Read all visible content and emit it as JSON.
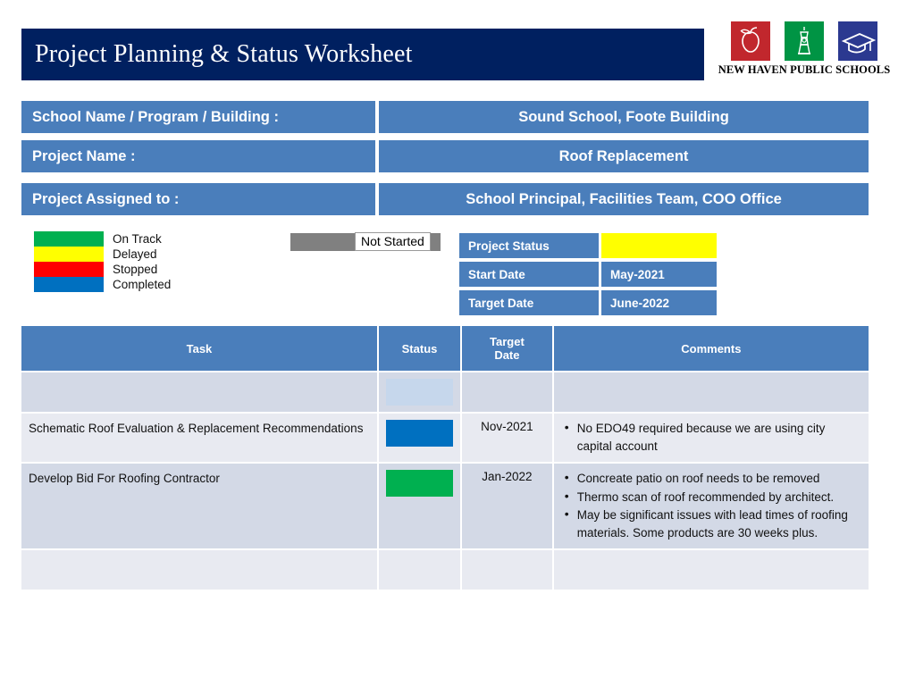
{
  "title": "Project Planning & Status Worksheet",
  "logo": {
    "caption": "NEW HAVEN PUBLIC SCHOOLS",
    "marks": [
      {
        "name": "apple-logo-icon",
        "color": "#C1272D"
      },
      {
        "name": "lighthouse-logo-icon",
        "color": "#009444"
      },
      {
        "name": "graduation-cap-logo-icon",
        "color": "#2B3990"
      }
    ]
  },
  "info_rows": [
    {
      "label": "School Name / Program / Building :",
      "value": "Sound School, Foote Building"
    },
    {
      "label": "Project Name :",
      "value": "Roof Replacement"
    },
    {
      "label": "Project Assigned to :",
      "value": "School Principal, Facilities Team, COO Office"
    }
  ],
  "legend": [
    {
      "label": "On Track",
      "color": "#00B050"
    },
    {
      "label": "Delayed",
      "color": "#FFFF00"
    },
    {
      "label": "Stopped",
      "color": "#FF0000"
    },
    {
      "label": "Completed",
      "color": "#0070C0"
    }
  ],
  "not_started": {
    "label": "Not Started",
    "color": "#808080"
  },
  "status_panel": [
    {
      "key": "Project Status",
      "value": "",
      "swatch_color": "#FFFF00"
    },
    {
      "key": "Start Date",
      "value": "May-2021",
      "swatch_color": ""
    },
    {
      "key": "Target  Date",
      "value": "June-2022",
      "swatch_color": ""
    }
  ],
  "table": {
    "headers": [
      "Task",
      "Status",
      "Target Date",
      "Comments"
    ],
    "header_target_line1": "Target",
    "header_target_line2": "Date",
    "rows": [
      {
        "task": "",
        "status_color": "#C6D7EC",
        "target_date": "",
        "comments": []
      },
      {
        "task": "Schematic Roof Evaluation & Replacement Recommendations",
        "status_color": "#0070C0",
        "target_date": "Nov-2021",
        "comments": [
          "No EDO49 required because we are using city capital account"
        ]
      },
      {
        "task": "Develop Bid For Roofing Contractor",
        "status_color": "#00B050",
        "target_date": "Jan-2022",
        "comments": [
          "Concreate patio on roof needs to be removed",
          "Thermo scan of roof recommended by architect.",
          "May be significant issues with lead times of roofing materials.  Some products are 30 weeks plus."
        ]
      },
      {
        "task": "",
        "status_color": "",
        "target_date": "",
        "comments": []
      }
    ]
  },
  "colors": {
    "navy": "#002060",
    "panel_blue": "#4A7EBB",
    "row_dark": "#D3D9E6",
    "row_light": "#E8EAF1"
  }
}
